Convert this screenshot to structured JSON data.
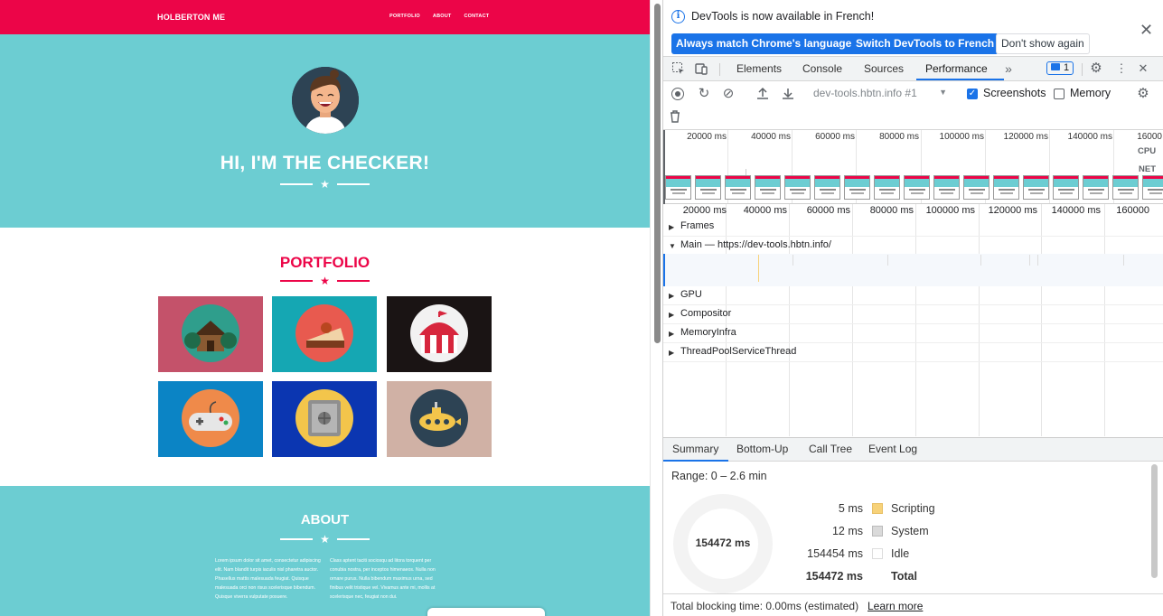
{
  "website": {
    "brand": "HOLBERTON ME",
    "nav_links": [
      "PORTFOLIO",
      "ABOUT",
      "CONTACT"
    ],
    "hero_title": "HI, I'M THE CHECKER!",
    "portfolio_title": "PORTFOLIO",
    "about_title": "ABOUT",
    "about_col1": "Lorem ipsum dolor sit amet, consectetur adipiscing elit. Nam blandit turpis iaculis nisl pharetra auctor. Phasellus mattis malesuada feugiat. Quisque malesuada orci non risus scelerisque bibendum. Quisque viverra vulputate posuere.",
    "about_col2": "Class aptent taciti sociosqu ad litora torquent per conubia nostra, per inceptos himenaeos. Nulla non ornare purus. Nulla bibendum maximus urna, sed finibus velit tristique vel. Vivamus ante mi, mollis at scelerisque nec, feugiat non dui.",
    "colors": {
      "brand_red": "#ec0548",
      "teal": "#6ccdd2"
    }
  },
  "devtools": {
    "infobar": {
      "message": "DevTools is now available in French!",
      "btn_match": "Always match Chrome's language",
      "btn_switch": "Switch DevTools to French",
      "btn_dont_show": "Don't show again"
    },
    "tabs": [
      "Elements",
      "Console",
      "Sources",
      "Performance"
    ],
    "active_tab": "Performance",
    "issues_count": "1",
    "target": "dev-tools.hbtn.info #1",
    "screenshots_label": "Screenshots",
    "memory_label": "Memory",
    "overview_labels": [
      "20000 ms",
      "40000 ms",
      "60000 ms",
      "80000 ms",
      "100000 ms",
      "120000 ms",
      "140000 ms",
      "16000"
    ],
    "cpu_label": "CPU",
    "net_label": "NET",
    "timeline_labels": [
      "20000 ms",
      "40000 ms",
      "60000 ms",
      "80000 ms",
      "100000 ms",
      "120000 ms",
      "140000 ms",
      "160000"
    ],
    "tracks": {
      "frames": "Frames",
      "main": "Main — https://dev-tools.hbtn.info/",
      "gpu": "GPU",
      "compositor": "Compositor",
      "memoryinfra": "MemoryInfra",
      "threadpool": "ThreadPoolServiceThread"
    },
    "bottom_tabs": [
      "Summary",
      "Bottom-Up",
      "Call Tree",
      "Event Log"
    ],
    "summary": {
      "range": "Range: 0 – 2.6 min",
      "donut_label": "154472 ms",
      "rows": [
        {
          "value": "5 ms",
          "name": "Scripting",
          "color": "#f7d279"
        },
        {
          "value": "12 ms",
          "name": "System",
          "color": "#dadada"
        },
        {
          "value": "154454 ms",
          "name": "Idle",
          "color": "#ffffff"
        },
        {
          "value": "154472 ms",
          "name": "Total",
          "color": ""
        }
      ]
    },
    "footer_text": "Total blocking time: 0.00ms (estimated)",
    "learn_more": "Learn more"
  }
}
